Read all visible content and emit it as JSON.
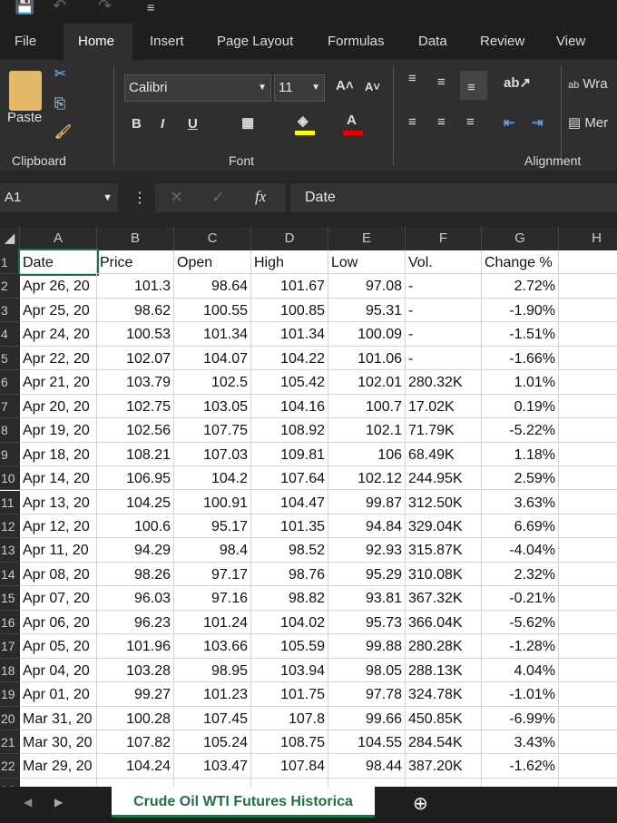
{
  "qat": {
    "icons": [
      "save-icon",
      "undo-icon",
      "redo-icon",
      "customize-icon"
    ]
  },
  "tabs": [
    "File",
    "Home",
    "Insert",
    "Page Layout",
    "Formulas",
    "Data",
    "Review",
    "View"
  ],
  "active_tab": "Home",
  "ribbon": {
    "clipboard": {
      "label": "Clipboard",
      "paste": "Paste"
    },
    "font": {
      "label": "Font",
      "font_name": "Calibri",
      "font_size": "11",
      "fill_color": "#ffff00",
      "font_color": "#ff0000"
    },
    "alignment": {
      "label": "Alignment",
      "wrap": "Wra",
      "merge": "Mer"
    }
  },
  "formula_bar": {
    "name_box": "A1",
    "formula": "Date"
  },
  "columns": [
    "A",
    "B",
    "C",
    "D",
    "E",
    "F",
    "G",
    "H"
  ],
  "rows": [
    [
      "Date",
      "Price",
      "Open",
      "High",
      "Low",
      "Vol.",
      "Change %"
    ],
    [
      "Apr 26, 20",
      "101.3",
      "98.64",
      "101.67",
      "97.08",
      "-",
      "2.72%"
    ],
    [
      "Apr 25, 20",
      "98.62",
      "100.55",
      "100.85",
      "95.31",
      "-",
      "-1.90%"
    ],
    [
      "Apr 24, 20",
      "100.53",
      "101.34",
      "101.34",
      "100.09",
      "-",
      "-1.51%"
    ],
    [
      "Apr 22, 20",
      "102.07",
      "104.07",
      "104.22",
      "101.06",
      "-",
      "-1.66%"
    ],
    [
      "Apr 21, 20",
      "103.79",
      "102.5",
      "105.42",
      "102.01",
      "280.32K",
      "1.01%"
    ],
    [
      "Apr 20, 20",
      "102.75",
      "103.05",
      "104.16",
      "100.7",
      "17.02K",
      "0.19%"
    ],
    [
      "Apr 19, 20",
      "102.56",
      "107.75",
      "108.92",
      "102.1",
      "71.79K",
      "-5.22%"
    ],
    [
      "Apr 18, 20",
      "108.21",
      "107.03",
      "109.81",
      "106",
      "68.49K",
      "1.18%"
    ],
    [
      "Apr 14, 20",
      "106.95",
      "104.2",
      "107.64",
      "102.12",
      "244.95K",
      "2.59%"
    ],
    [
      "Apr 13, 20",
      "104.25",
      "100.91",
      "104.47",
      "99.87",
      "312.50K",
      "3.63%"
    ],
    [
      "Apr 12, 20",
      "100.6",
      "95.17",
      "101.35",
      "94.84",
      "329.04K",
      "6.69%"
    ],
    [
      "Apr 11, 20",
      "94.29",
      "98.4",
      "98.52",
      "92.93",
      "315.87K",
      "-4.04%"
    ],
    [
      "Apr 08, 20",
      "98.26",
      "97.17",
      "98.76",
      "95.29",
      "310.08K",
      "2.32%"
    ],
    [
      "Apr 07, 20",
      "96.03",
      "97.16",
      "98.82",
      "93.81",
      "367.32K",
      "-0.21%"
    ],
    [
      "Apr 06, 20",
      "96.23",
      "101.24",
      "104.02",
      "95.73",
      "366.04K",
      "-5.62%"
    ],
    [
      "Apr 05, 20",
      "101.96",
      "103.66",
      "105.59",
      "99.88",
      "280.28K",
      "-1.28%"
    ],
    [
      "Apr 04, 20",
      "103.28",
      "98.95",
      "103.94",
      "98.05",
      "288.13K",
      "4.04%"
    ],
    [
      "Apr 01, 20",
      "99.27",
      "101.23",
      "101.75",
      "97.78",
      "324.78K",
      "-1.01%"
    ],
    [
      "Mar 31, 20",
      "100.28",
      "107.45",
      "107.8",
      "99.66",
      "450.85K",
      "-6.99%"
    ],
    [
      "Mar 30, 20",
      "107.82",
      "105.24",
      "108.75",
      "104.55",
      "284.54K",
      "3.43%"
    ],
    [
      "Mar 29, 20",
      "104.24",
      "103.47",
      "107.84",
      "98.44",
      "387.20K",
      "-1.62%"
    ]
  ],
  "sheet_tab": "Crude Oil WTI Futures Historica"
}
